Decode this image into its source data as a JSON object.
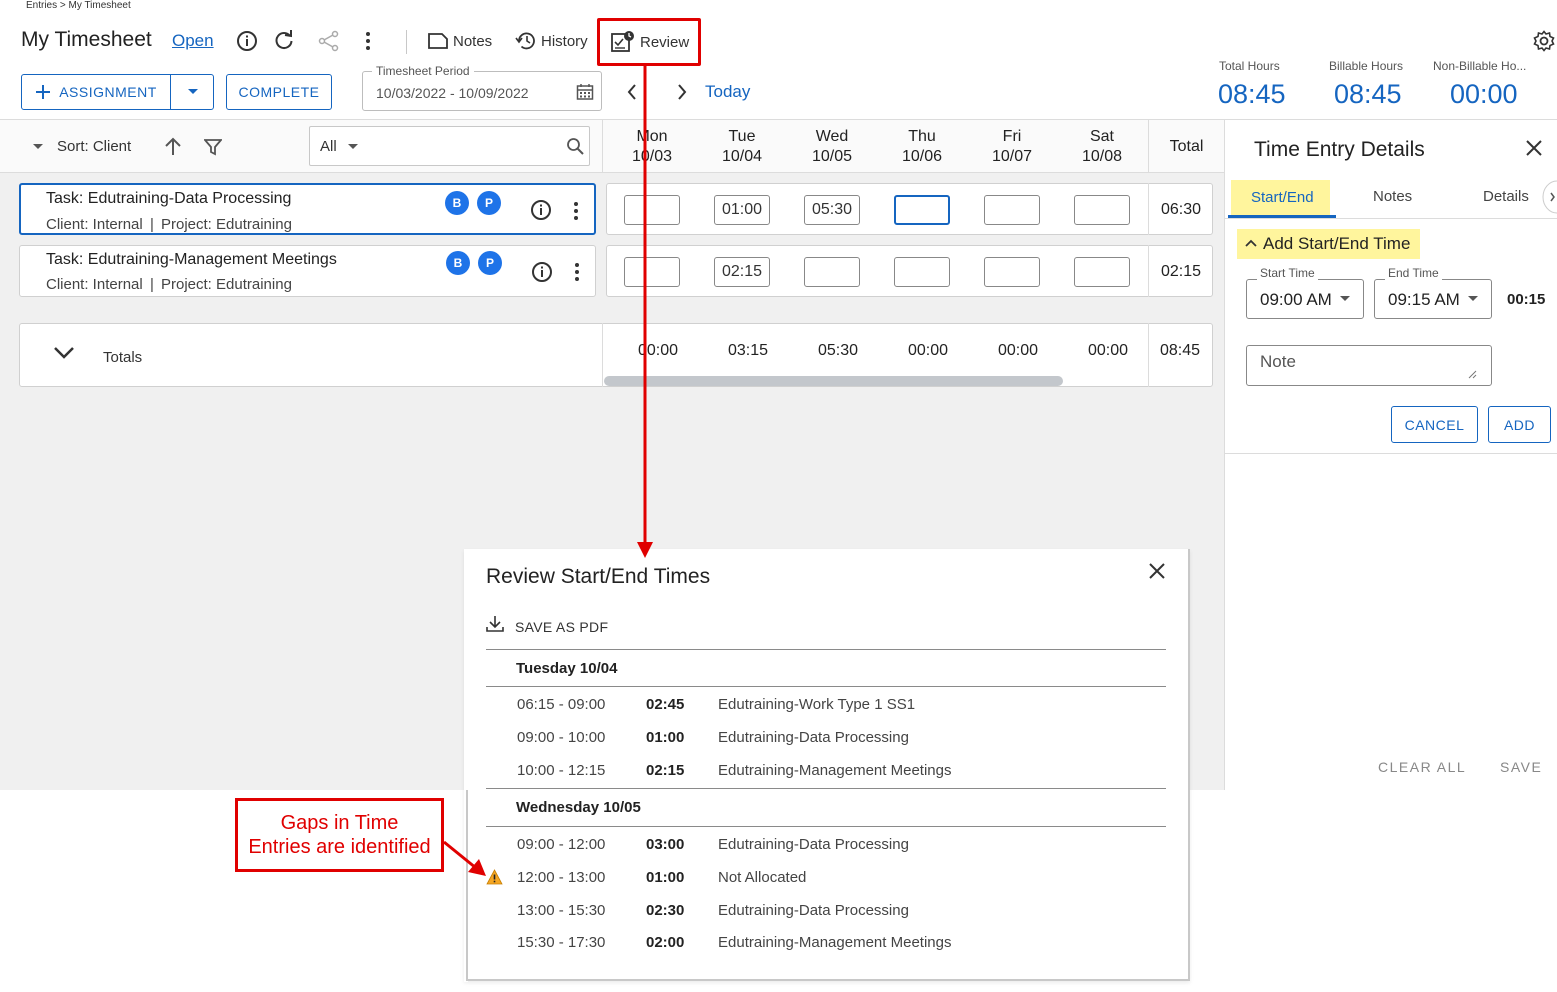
{
  "breadcrumb": "Entries > My Timesheet",
  "header": {
    "title": "My Timesheet",
    "status_link": "Open",
    "notes_label": "Notes",
    "history_label": "History",
    "review_label": "Review"
  },
  "actions": {
    "assignment_label": "ASSIGNMENT",
    "complete_label": "COMPLETE",
    "period_label": "Timesheet Period",
    "period_value": "10/03/2022 - 10/09/2022",
    "today_label": "Today"
  },
  "stats": [
    {
      "label": "Total Hours",
      "value": "08:45"
    },
    {
      "label": "Billable Hours",
      "value": "08:45"
    },
    {
      "label": "Non-Billable Ho...",
      "value": "00:00"
    }
  ],
  "grid": {
    "sort_label": "Sort: Client",
    "filter_value": "All",
    "days": [
      {
        "name": "Mon",
        "date": "10/03"
      },
      {
        "name": "Tue",
        "date": "10/04"
      },
      {
        "name": "Wed",
        "date": "10/05"
      },
      {
        "name": "Thu",
        "date": "10/06"
      },
      {
        "name": "Fri",
        "date": "10/07"
      },
      {
        "name": "Sat",
        "date": "10/08"
      }
    ],
    "total_header": "Total",
    "rows": [
      {
        "task": "Task: Edutraining-Data Processing",
        "client": "Client: Internal",
        "project": "Project: Edutraining",
        "badges": [
          "B",
          "P"
        ],
        "cells": [
          "",
          "01:00",
          "05:30",
          "",
          "",
          ""
        ],
        "total": "06:30"
      },
      {
        "task": "Task: Edutraining-Management Meetings",
        "client": "Client: Internal",
        "project": "Project: Edutraining",
        "badges": [
          "B",
          "P"
        ],
        "cells": [
          "",
          "02:15",
          "",
          "",
          "",
          ""
        ],
        "total": "02:15"
      }
    ],
    "totals_label": "Totals",
    "totals": [
      "00:00",
      "03:15",
      "05:30",
      "00:00",
      "00:00",
      "00:00"
    ],
    "grand_total": "08:45",
    "separator": "|"
  },
  "panel": {
    "title": "Time Entry Details",
    "tabs": [
      "Start/End",
      "Notes",
      "Details"
    ],
    "add_label": "Add Start/End Time",
    "start_label": "Start Time",
    "start_value": "09:00 AM",
    "end_label": "End Time",
    "end_value": "09:15 AM",
    "duration": "00:15",
    "note_placeholder": "Note",
    "cancel_label": "CANCEL",
    "add_btn_label": "ADD",
    "clear_all_label": "CLEAR ALL",
    "save_label": "SAVE"
  },
  "dialog": {
    "title": "Review Start/End Times",
    "save_pdf_label": "SAVE AS PDF",
    "groups": [
      {
        "day": "Tuesday 10/04",
        "entries": [
          {
            "time": "06:15 - 09:00",
            "duration": "02:45",
            "desc": "Edutraining-Work Type 1 SS1"
          },
          {
            "time": "09:00 - 10:00",
            "duration": "01:00",
            "desc": "Edutraining-Data Processing"
          },
          {
            "time": "10:00 - 12:15",
            "duration": "02:15",
            "desc": "Edutraining-Management Meetings"
          }
        ]
      },
      {
        "day": "Wednesday 10/05",
        "entries": [
          {
            "time": "09:00 - 12:00",
            "duration": "03:00",
            "desc": "Edutraining-Data Processing"
          },
          {
            "time": "12:00 - 13:00",
            "duration": "01:00",
            "desc": "Not Allocated",
            "warning": true
          },
          {
            "time": "13:00 - 15:30",
            "duration": "02:30",
            "desc": "Edutraining-Data Processing"
          },
          {
            "time": "15:30 - 17:30",
            "duration": "02:00",
            "desc": "Edutraining-Management Meetings"
          }
        ]
      }
    ]
  },
  "annotation": {
    "callout_line1": "Gaps in Time",
    "callout_line2": "Entries are identified",
    "color": "#e00000"
  },
  "colors": {
    "accent": "#1565c0",
    "badge": "#1e73e8",
    "highlight": "#fff59d",
    "warning": "#f5a623"
  },
  "icons": [
    "info-icon",
    "refresh-icon",
    "share-icon",
    "more-icon",
    "notes-icon",
    "history-icon",
    "review-icon",
    "settings-icon",
    "plus-icon",
    "calendar-icon",
    "chevron-left-icon",
    "chevron-right-icon",
    "sort-up-icon",
    "filter-icon",
    "search-icon",
    "close-icon",
    "download-icon",
    "warning-icon"
  ]
}
